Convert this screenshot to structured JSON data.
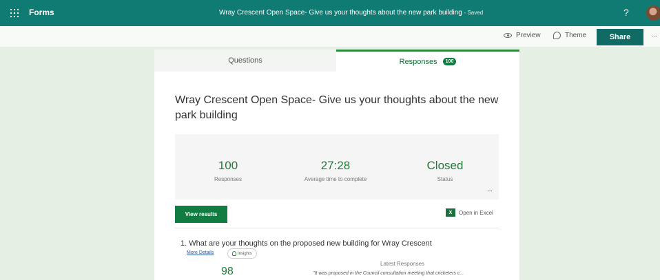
{
  "app": {
    "name": "Forms"
  },
  "header": {
    "title": "Wray Crescent Open Space- Give us your thoughts about the new park building",
    "saved_label": "- Saved",
    "help_icon": "?"
  },
  "toolbar": {
    "preview_label": "Preview",
    "theme_label": "Theme",
    "share_label": "Share",
    "more_label": "···"
  },
  "tabs": {
    "questions_label": "Questions",
    "responses_label": "Responses",
    "responses_count": "100"
  },
  "form": {
    "title": "Wray Crescent Open Space- Give us your thoughts about the new park building"
  },
  "summary": {
    "responses": {
      "value": "100",
      "label": "Responses"
    },
    "avg_time": {
      "value": "27:28",
      "label": "Average time to complete"
    },
    "status": {
      "value": "Closed",
      "label": "Status"
    },
    "more_label": "···"
  },
  "actions": {
    "view_results_label": "View results",
    "open_excel_label": "Open in Excel",
    "excel_icon_text": "X"
  },
  "question": {
    "text": "1.  What are your thoughts on the proposed new building for Wray Crescent",
    "more_details_label": "More Details",
    "insights_label": "Insights",
    "count": "98",
    "latest_label": "Latest Responses",
    "latest_text": "\"It was proposed in the Council consultation meeting that cricketers c..."
  },
  "colors": {
    "brand": "#0f7b72",
    "accent_green": "#107c41",
    "stat_green": "#217a3a",
    "page_bg": "#e6efe3"
  }
}
